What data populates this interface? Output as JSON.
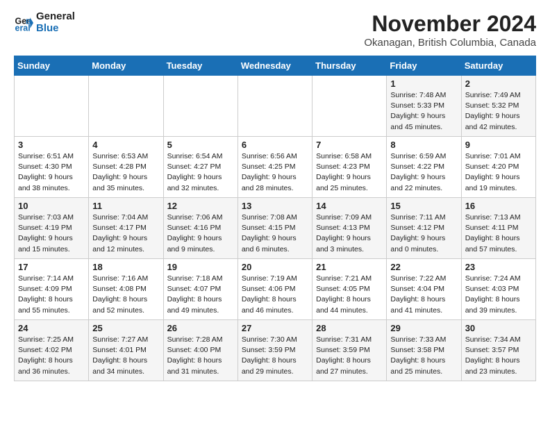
{
  "logo": {
    "line1": "General",
    "line2": "Blue"
  },
  "title": "November 2024",
  "location": "Okanagan, British Columbia, Canada",
  "weekdays": [
    "Sunday",
    "Monday",
    "Tuesday",
    "Wednesday",
    "Thursday",
    "Friday",
    "Saturday"
  ],
  "weeks": [
    [
      {
        "day": "",
        "sunrise": "",
        "sunset": "",
        "daylight": ""
      },
      {
        "day": "",
        "sunrise": "",
        "sunset": "",
        "daylight": ""
      },
      {
        "day": "",
        "sunrise": "",
        "sunset": "",
        "daylight": ""
      },
      {
        "day": "",
        "sunrise": "",
        "sunset": "",
        "daylight": ""
      },
      {
        "day": "",
        "sunrise": "",
        "sunset": "",
        "daylight": ""
      },
      {
        "day": "1",
        "sunrise": "Sunrise: 7:48 AM",
        "sunset": "Sunset: 5:33 PM",
        "daylight": "Daylight: 9 hours and 45 minutes."
      },
      {
        "day": "2",
        "sunrise": "Sunrise: 7:49 AM",
        "sunset": "Sunset: 5:32 PM",
        "daylight": "Daylight: 9 hours and 42 minutes."
      }
    ],
    [
      {
        "day": "3",
        "sunrise": "Sunrise: 6:51 AM",
        "sunset": "Sunset: 4:30 PM",
        "daylight": "Daylight: 9 hours and 38 minutes."
      },
      {
        "day": "4",
        "sunrise": "Sunrise: 6:53 AM",
        "sunset": "Sunset: 4:28 PM",
        "daylight": "Daylight: 9 hours and 35 minutes."
      },
      {
        "day": "5",
        "sunrise": "Sunrise: 6:54 AM",
        "sunset": "Sunset: 4:27 PM",
        "daylight": "Daylight: 9 hours and 32 minutes."
      },
      {
        "day": "6",
        "sunrise": "Sunrise: 6:56 AM",
        "sunset": "Sunset: 4:25 PM",
        "daylight": "Daylight: 9 hours and 28 minutes."
      },
      {
        "day": "7",
        "sunrise": "Sunrise: 6:58 AM",
        "sunset": "Sunset: 4:23 PM",
        "daylight": "Daylight: 9 hours and 25 minutes."
      },
      {
        "day": "8",
        "sunrise": "Sunrise: 6:59 AM",
        "sunset": "Sunset: 4:22 PM",
        "daylight": "Daylight: 9 hours and 22 minutes."
      },
      {
        "day": "9",
        "sunrise": "Sunrise: 7:01 AM",
        "sunset": "Sunset: 4:20 PM",
        "daylight": "Daylight: 9 hours and 19 minutes."
      }
    ],
    [
      {
        "day": "10",
        "sunrise": "Sunrise: 7:03 AM",
        "sunset": "Sunset: 4:19 PM",
        "daylight": "Daylight: 9 hours and 15 minutes."
      },
      {
        "day": "11",
        "sunrise": "Sunrise: 7:04 AM",
        "sunset": "Sunset: 4:17 PM",
        "daylight": "Daylight: 9 hours and 12 minutes."
      },
      {
        "day": "12",
        "sunrise": "Sunrise: 7:06 AM",
        "sunset": "Sunset: 4:16 PM",
        "daylight": "Daylight: 9 hours and 9 minutes."
      },
      {
        "day": "13",
        "sunrise": "Sunrise: 7:08 AM",
        "sunset": "Sunset: 4:15 PM",
        "daylight": "Daylight: 9 hours and 6 minutes."
      },
      {
        "day": "14",
        "sunrise": "Sunrise: 7:09 AM",
        "sunset": "Sunset: 4:13 PM",
        "daylight": "Daylight: 9 hours and 3 minutes."
      },
      {
        "day": "15",
        "sunrise": "Sunrise: 7:11 AM",
        "sunset": "Sunset: 4:12 PM",
        "daylight": "Daylight: 9 hours and 0 minutes."
      },
      {
        "day": "16",
        "sunrise": "Sunrise: 7:13 AM",
        "sunset": "Sunset: 4:11 PM",
        "daylight": "Daylight: 8 hours and 57 minutes."
      }
    ],
    [
      {
        "day": "17",
        "sunrise": "Sunrise: 7:14 AM",
        "sunset": "Sunset: 4:09 PM",
        "daylight": "Daylight: 8 hours and 55 minutes."
      },
      {
        "day": "18",
        "sunrise": "Sunrise: 7:16 AM",
        "sunset": "Sunset: 4:08 PM",
        "daylight": "Daylight: 8 hours and 52 minutes."
      },
      {
        "day": "19",
        "sunrise": "Sunrise: 7:18 AM",
        "sunset": "Sunset: 4:07 PM",
        "daylight": "Daylight: 8 hours and 49 minutes."
      },
      {
        "day": "20",
        "sunrise": "Sunrise: 7:19 AM",
        "sunset": "Sunset: 4:06 PM",
        "daylight": "Daylight: 8 hours and 46 minutes."
      },
      {
        "day": "21",
        "sunrise": "Sunrise: 7:21 AM",
        "sunset": "Sunset: 4:05 PM",
        "daylight": "Daylight: 8 hours and 44 minutes."
      },
      {
        "day": "22",
        "sunrise": "Sunrise: 7:22 AM",
        "sunset": "Sunset: 4:04 PM",
        "daylight": "Daylight: 8 hours and 41 minutes."
      },
      {
        "day": "23",
        "sunrise": "Sunrise: 7:24 AM",
        "sunset": "Sunset: 4:03 PM",
        "daylight": "Daylight: 8 hours and 39 minutes."
      }
    ],
    [
      {
        "day": "24",
        "sunrise": "Sunrise: 7:25 AM",
        "sunset": "Sunset: 4:02 PM",
        "daylight": "Daylight: 8 hours and 36 minutes."
      },
      {
        "day": "25",
        "sunrise": "Sunrise: 7:27 AM",
        "sunset": "Sunset: 4:01 PM",
        "daylight": "Daylight: 8 hours and 34 minutes."
      },
      {
        "day": "26",
        "sunrise": "Sunrise: 7:28 AM",
        "sunset": "Sunset: 4:00 PM",
        "daylight": "Daylight: 8 hours and 31 minutes."
      },
      {
        "day": "27",
        "sunrise": "Sunrise: 7:30 AM",
        "sunset": "Sunset: 3:59 PM",
        "daylight": "Daylight: 8 hours and 29 minutes."
      },
      {
        "day": "28",
        "sunrise": "Sunrise: 7:31 AM",
        "sunset": "Sunset: 3:59 PM",
        "daylight": "Daylight: 8 hours and 27 minutes."
      },
      {
        "day": "29",
        "sunrise": "Sunrise: 7:33 AM",
        "sunset": "Sunset: 3:58 PM",
        "daylight": "Daylight: 8 hours and 25 minutes."
      },
      {
        "day": "30",
        "sunrise": "Sunrise: 7:34 AM",
        "sunset": "Sunset: 3:57 PM",
        "daylight": "Daylight: 8 hours and 23 minutes."
      }
    ]
  ]
}
